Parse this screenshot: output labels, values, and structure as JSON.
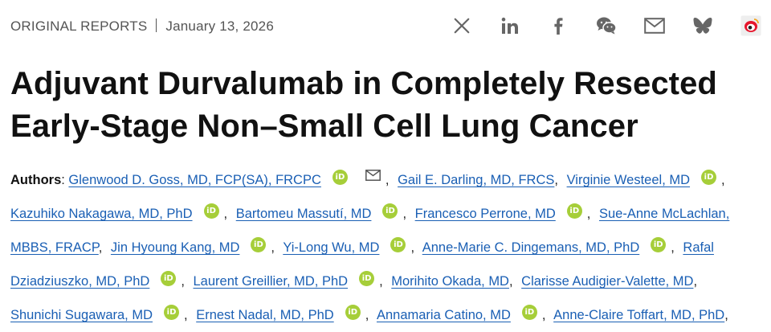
{
  "header": {
    "category": "ORIGINAL REPORTS",
    "date": "January 13, 2026"
  },
  "share_icons": [
    "x-icon",
    "linkedin-icon",
    "facebook-icon",
    "wechat-icon",
    "email-icon",
    "bluesky-icon",
    "weibo-icon"
  ],
  "article": {
    "title_line1": "Adjuvant Durvalumab in Completely Resected",
    "title_line2": "Early-Stage Non–Small Cell Lung Cancer",
    "authors_label": "Authors",
    "authors": [
      "Glenwood D. Goss, MD, FCP(SA), FRCPC",
      "Gail E. Darling, MD, FRCS",
      "Virginie Westeel, MD",
      "Kazuhiko Nakagawa, MD, PhD",
      "Bartomeu Massutí, MD",
      "Francesco Perrone, MD",
      "Sue-Anne McLachlan,",
      "MBBS, FRACP",
      "Jin Hyoung Kang, MD",
      "Yi-Long Wu, MD",
      "Anne-Marie C. Dingemans, MD, PhD",
      "Rafal",
      "Dziadziuszko, MD, PhD",
      "Laurent Greillier, MD, PhD",
      "Morihito Okada, MD",
      "Clarisse Audigier-Valette, MD",
      "Shunichi Sugawara, MD",
      "Ernest Nadal, MD, PhD",
      "Annamaria Catino, MD",
      "Anne-Claire Toffart, MD, PhD"
    ],
    "orcid_badge": "iD"
  },
  "colors": {
    "link": "#1a5fb4",
    "orcid": "#a6ce39",
    "icon_gray": "#666666"
  }
}
